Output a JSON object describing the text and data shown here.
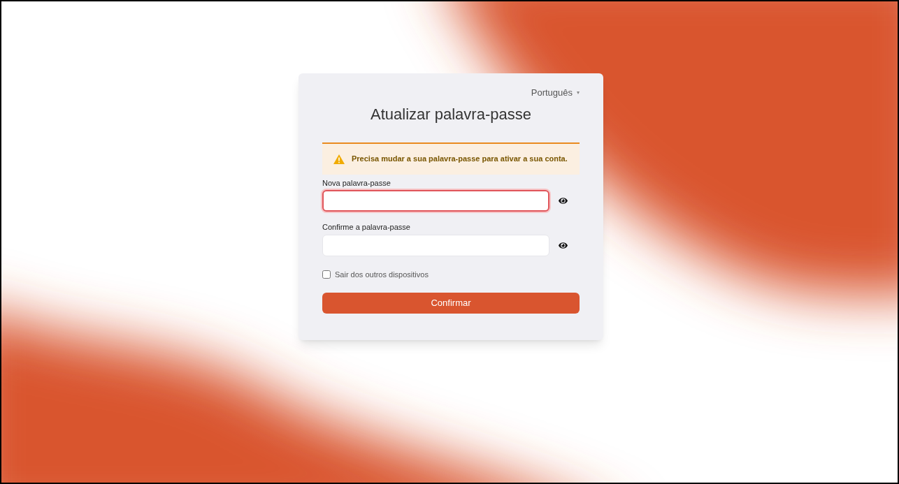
{
  "language": {
    "label": "Português",
    "caret": "▾"
  },
  "title": "Atualizar palavra-passe",
  "alert": {
    "message": "Precisa mudar a sua palavra-passe para ativar a sua conta."
  },
  "fields": [
    {
      "label": "Nova palavra-passe",
      "invalid": true
    },
    {
      "label": "Confirme a palavra-passe",
      "invalid": false
    }
  ],
  "logout_others": {
    "label": "Sair dos outros dispositivos",
    "checked": false
  },
  "submit": {
    "label": "Confirmar"
  }
}
